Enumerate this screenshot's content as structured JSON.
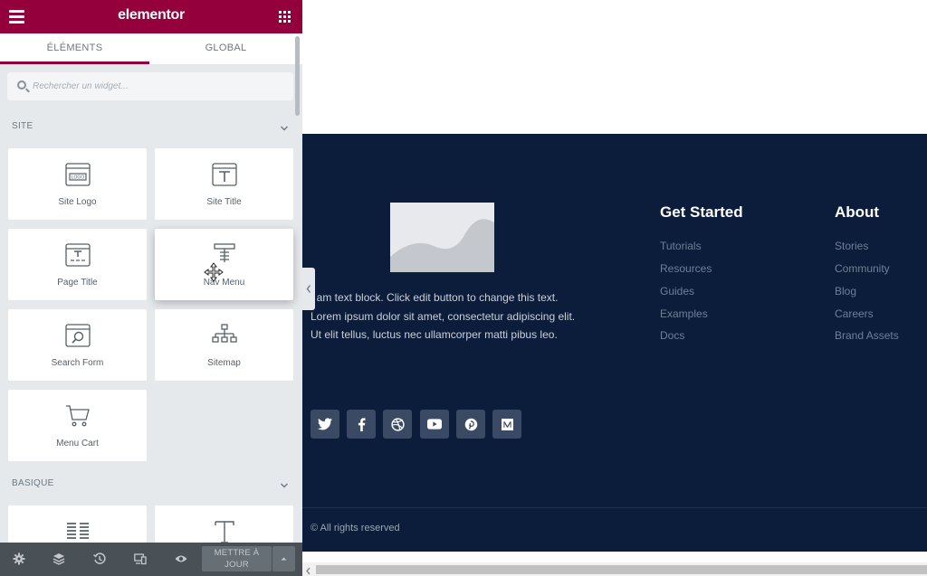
{
  "panel": {
    "brand": "elementor",
    "tabs": [
      "ÉLÉMENTS",
      "GLOBAL"
    ],
    "active_tab": "ÉLÉMENTS",
    "search_placeholder": "Rechercher un widget..."
  },
  "categories": {
    "site": {
      "title": "SITE",
      "widgets": [
        {
          "label": "Site Logo",
          "icon": "site-logo-icon"
        },
        {
          "label": "Site Title",
          "icon": "site-title-icon"
        },
        {
          "label": "Page Title",
          "icon": "page-title-icon"
        },
        {
          "label": "Nav Menu",
          "icon": "nav-menu-icon"
        },
        {
          "label": "Search Form",
          "icon": "search-form-icon"
        },
        {
          "label": "Sitemap",
          "icon": "sitemap-icon"
        },
        {
          "label": "Menu Cart",
          "icon": "cart-icon"
        }
      ]
    },
    "basic": {
      "title": "BASIQUE"
    }
  },
  "bottom_bar": {
    "update_label_line1": "METTRE À",
    "update_label_line2": "JOUR",
    "icons": [
      "settings-icon",
      "layers-icon",
      "history-icon",
      "responsive-icon",
      "preview-icon"
    ]
  },
  "footer": {
    "text_block": "I am text block. Click edit button to change this text. Lorem ipsum dolor sit amet, consectetur adipiscing elit. Ut elit tellus, luctus nec ullamcorper matti pibus leo.",
    "columns": [
      {
        "title": "Get Started",
        "links": [
          "Tutorials",
          "Resources",
          "Guides",
          "Examples",
          "Docs"
        ]
      },
      {
        "title": "About",
        "links": [
          "Stories",
          "Community",
          "Blog",
          "Careers",
          "Brand Assets"
        ]
      }
    ],
    "social_icons": [
      "twitter-icon",
      "facebook-icon",
      "dribbble-icon",
      "youtube-icon",
      "pinterest-icon",
      "medium-icon"
    ],
    "copyright": "© All rights reserved"
  },
  "colors": {
    "brand": "#93003c",
    "panel_bg": "#e6e9ec",
    "footer_bg": "#0b1d3a",
    "bottom_bar": "#495157"
  }
}
